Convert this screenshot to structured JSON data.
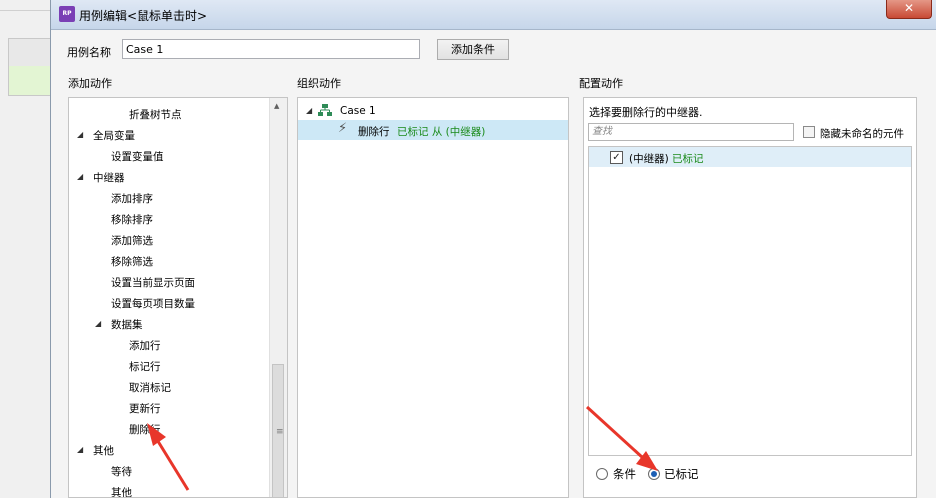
{
  "window": {
    "title": "用例编辑<鼠标单击时>",
    "app_icon": "RP",
    "close_symbol": "✕"
  },
  "case": {
    "label": "用例名称",
    "value": "Case 1",
    "add_condition": "添加条件"
  },
  "sections": {
    "add_action": "添加动作",
    "organize_action": "组织动作",
    "configure_action": "配置动作"
  },
  "add_action_tree": [
    {
      "label": "折叠树节点",
      "level": 3,
      "expander": ""
    },
    {
      "label": "全局变量",
      "level": 1,
      "expander": "◢"
    },
    {
      "label": "设置变量值",
      "level": 2,
      "expander": ""
    },
    {
      "label": "中继器",
      "level": 1,
      "expander": "◢"
    },
    {
      "label": "添加排序",
      "level": 2,
      "expander": ""
    },
    {
      "label": "移除排序",
      "level": 2,
      "expander": ""
    },
    {
      "label": "添加筛选",
      "level": 2,
      "expander": ""
    },
    {
      "label": "移除筛选",
      "level": 2,
      "expander": ""
    },
    {
      "label": "设置当前显示页面",
      "level": 2,
      "expander": ""
    },
    {
      "label": "设置每页项目数量",
      "level": 2,
      "expander": ""
    },
    {
      "label": "数据集",
      "level": 2,
      "expander": "◢"
    },
    {
      "label": "添加行",
      "level": 3,
      "expander": ""
    },
    {
      "label": "标记行",
      "level": 3,
      "expander": ""
    },
    {
      "label": "取消标记",
      "level": 3,
      "expander": ""
    },
    {
      "label": "更新行",
      "level": 3,
      "expander": ""
    },
    {
      "label": "删除行",
      "level": 3,
      "expander": ""
    },
    {
      "label": "其他",
      "level": 1,
      "expander": "◢"
    },
    {
      "label": "等待",
      "level": 2,
      "expander": ""
    },
    {
      "label": "其他",
      "level": 2,
      "expander": ""
    }
  ],
  "organize": {
    "case_name": "Case 1",
    "action_verb": "删除行",
    "action_detail": "已标记 从 (中继器)"
  },
  "configure": {
    "instruction": "选择要删除行的中继器.",
    "search_placeholder": "查找",
    "hide_unnamed": "隐藏未命名的元件",
    "repeater_prefix": "(中继器)",
    "repeater_status": "已标记",
    "repeater_checked": true,
    "radio_condition": "条件",
    "radio_marked": "已标记",
    "selected_radio": "已标记"
  },
  "colors": {
    "accent_green": "#1a8a1a",
    "selection_blue": "#cde8f6",
    "annotation_red": "#e8362a"
  }
}
